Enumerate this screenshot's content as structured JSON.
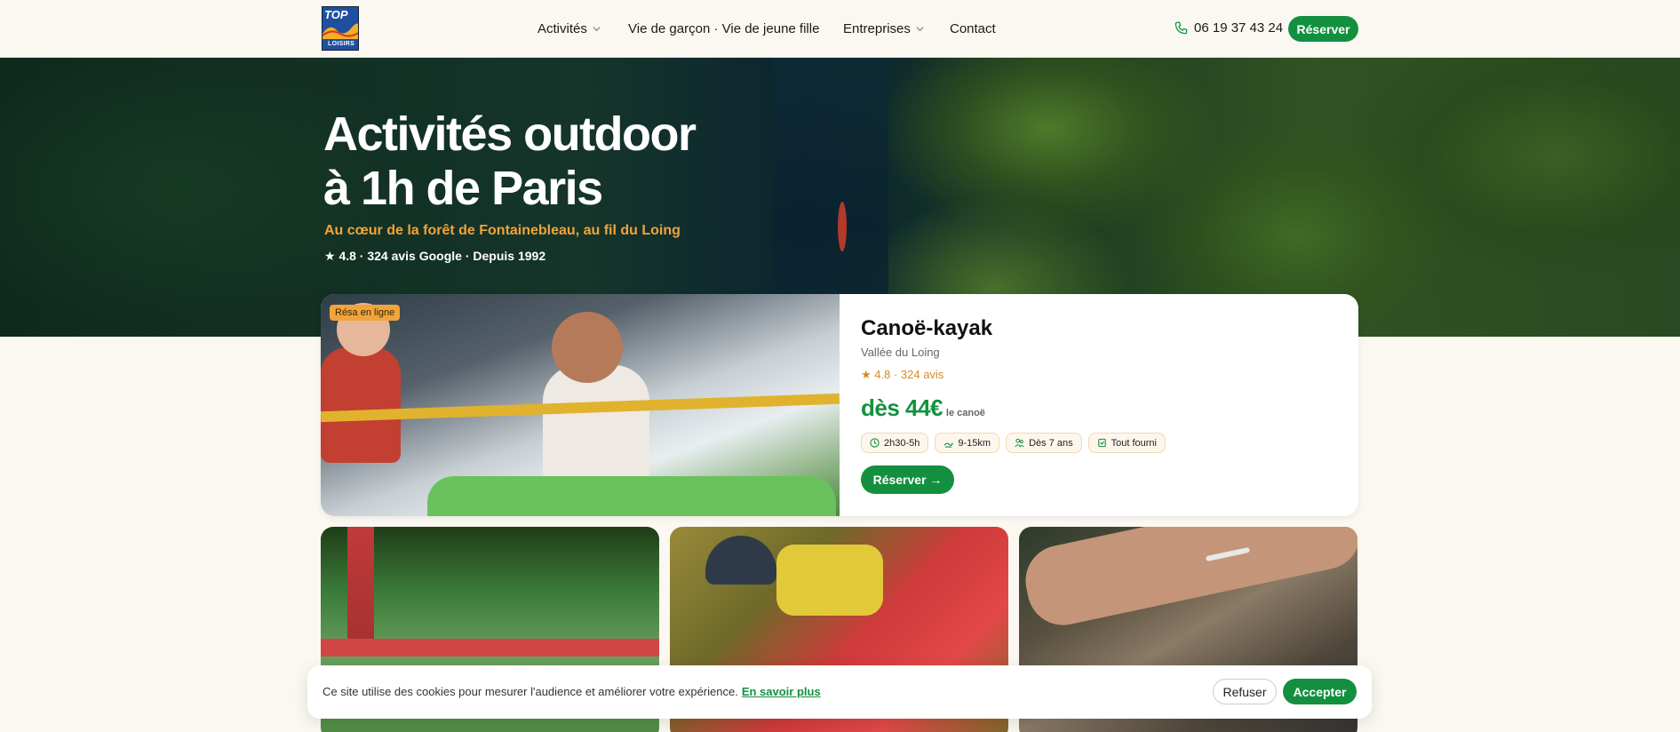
{
  "nav": {
    "logo_top": "TOP",
    "logo_bottom": "LOISIRS",
    "items": [
      {
        "label": "Activités",
        "has_dropdown": true
      },
      {
        "label": "Vie de garçon · Vie de jeune fille",
        "has_dropdown": false
      },
      {
        "label": "Entreprises",
        "has_dropdown": true
      },
      {
        "label": "Contact",
        "has_dropdown": false
      }
    ],
    "phone": "06 19 37 43 24",
    "reserve_label": "Réserver"
  },
  "hero": {
    "title": "Activités outdoor\nà 1h de Paris",
    "subtitle": "Au cœur de la forêt de Fontainebleau, au fil du Loing",
    "rating_line": "★ 4.8 · 324 avis Google · Depuis 1992"
  },
  "featured": {
    "badge": "Résa en ligne",
    "title": "Canoë-kayak",
    "location": "Vallée du Loing",
    "rating": "★ 4.8 · 324 avis",
    "price": "dès 44€",
    "price_unit": "le canoë",
    "tags": [
      {
        "icon": "clock-icon",
        "label": "2h30-5h"
      },
      {
        "icon": "distance-icon",
        "label": "9-15km"
      },
      {
        "icon": "people-icon",
        "label": "Dès 7 ans"
      },
      {
        "icon": "equipment-icon",
        "label": "Tout fourni"
      }
    ],
    "reserve_label": "Réserver →"
  },
  "cookie": {
    "text": "Ce site utilise des cookies pour mesurer l'audience et améliorer votre expérience.",
    "link": "En savoir plus",
    "refuse_label": "Refuser",
    "accept_label": "Accepter"
  },
  "colors": {
    "accent_green": "#13903f",
    "accent_orange": "#f0a43a",
    "background": "#fbf8f2"
  }
}
